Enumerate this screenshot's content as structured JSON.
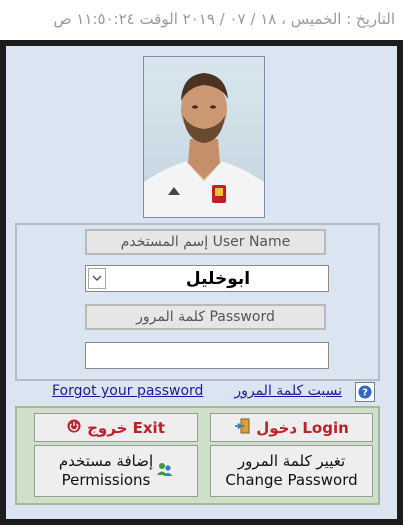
{
  "header": {
    "date_time": "التاريخ : الخميس ، ١٨ / ٠٧ / ٢٠١٩  الوقت  ١١:٥٠:٢٤ ص"
  },
  "photo": {
    "name": "user-photo"
  },
  "login": {
    "username_label": "إسم المستخدم User Name",
    "username_value": "ابوخليل",
    "password_label": "كلمة المرور   Password",
    "password_value": ""
  },
  "links": {
    "forgot_en": "Forgot your password",
    "forgot_ar": "نسيت كلمة المرور"
  },
  "buttons": {
    "login": "دخول Login",
    "exit": "خروج Exit",
    "change_password_ar": "تغيير كلمة المرور",
    "change_password_en": "Change Password",
    "permissions_ar": "إضافة مستخدم",
    "permissions_en": "Permissions"
  },
  "colors": {
    "panel_background": "#dbe5f2",
    "button_panel_background": "#cfe0c8",
    "action_text_red": "#c0202a",
    "link_blue": "#1a1aa6"
  },
  "icons": [
    "door-exit-icon",
    "power-icon",
    "users-icon",
    "help-icon",
    "chevron-down-icon"
  ]
}
